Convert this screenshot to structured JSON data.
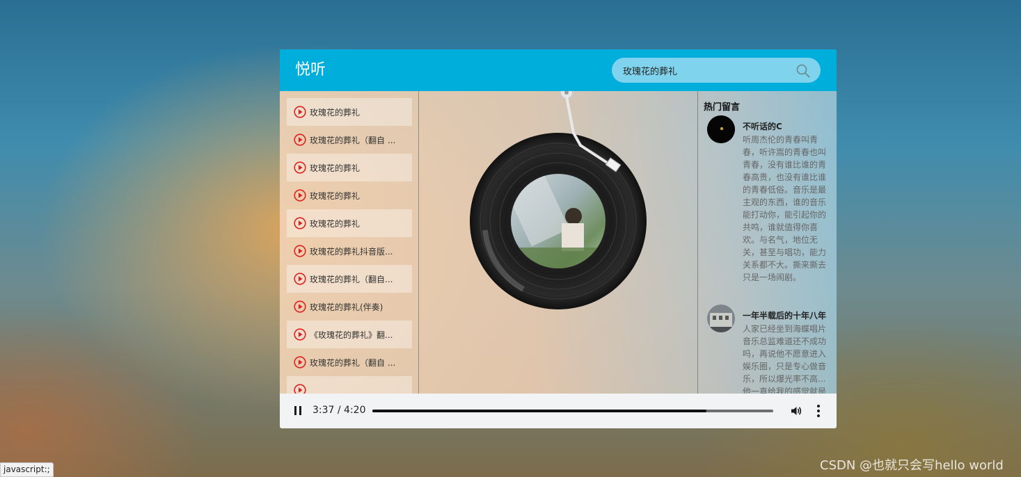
{
  "app": {
    "title": "悦听"
  },
  "search": {
    "value": "玫瑰花的葬礼",
    "placeholder": ""
  },
  "playlist": {
    "items": [
      {
        "label": "玫瑰花的葬礼"
      },
      {
        "label": "玫瑰花的葬礼（翻自 ..."
      },
      {
        "label": "玫瑰花的葬礼"
      },
      {
        "label": "玫瑰花的葬礼"
      },
      {
        "label": "玫瑰花的葬礼"
      },
      {
        "label": "玫瑰花的葬礼抖音版..."
      },
      {
        "label": "玫瑰花的葬礼（翻自..."
      },
      {
        "label": "玫瑰花的葬礼(伴奏)"
      },
      {
        "label": "《玫瑰花的葬礼》翻..."
      },
      {
        "label": "玫瑰花的葬礼（翻自 ..."
      },
      {
        "label": ""
      }
    ]
  },
  "comments": {
    "title": "热门留言",
    "items": [
      {
        "user": "不听话的C",
        "text": "听周杰伦的青春叫青春，听许嵩的青春也叫青春，没有谁比谁的青春高贵，也没有谁比谁的青春低俗。音乐是最主观的东西，谁的音乐能打动你，能引起你的共鸣，谁就值得你喜欢。与名气，地位无关，甚至与唱功，能力关系都不大。撕来撕去只是一场闹剧。"
      },
      {
        "user": "一年半载后的十年八年",
        "text": "人家已经坐到海蝶唱片音乐总监难道还不成功吗，再说他不愿意进入娱乐圈，只是专心做音乐，所以爆光率不高...他一直给我的感觉就是"
      }
    ]
  },
  "audio": {
    "time_display": "3:37 / 4:20",
    "progress_fraction": 0.834
  },
  "browser": {
    "status_link": "javascript:;"
  },
  "watermark": {
    "text": "CSDN @也就只会写hello world"
  },
  "colors": {
    "header": "#00aedc",
    "search_bg": "#7fd3ec",
    "play_icon": "#e02020",
    "controls_bg": "#f1f3f4"
  },
  "icons": {
    "search": "search-icon",
    "play": "play-circle-icon",
    "pause": "pause-icon",
    "volume": "volume-icon",
    "more": "more-vertical-icon"
  }
}
